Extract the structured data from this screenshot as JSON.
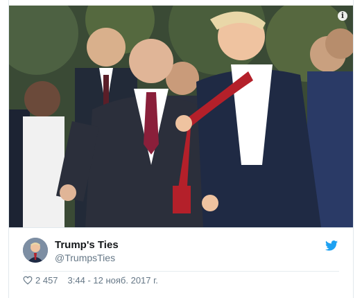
{
  "tweet": {
    "display_name": "Trump's Ties",
    "handle": "@TrumpsTies",
    "like_count": "2 457",
    "timestamp": "3:44 - 12 нояб. 2017 г.",
    "info_badge": "i"
  },
  "icons": {
    "bird": "twitter-bird-icon",
    "heart": "heart-icon",
    "info": "info-icon"
  },
  "colors": {
    "brand_blue": "#1da1f2",
    "muted_text": "#657786",
    "tie_red": "#b4202a",
    "suit_navy": "#1f2a44"
  }
}
